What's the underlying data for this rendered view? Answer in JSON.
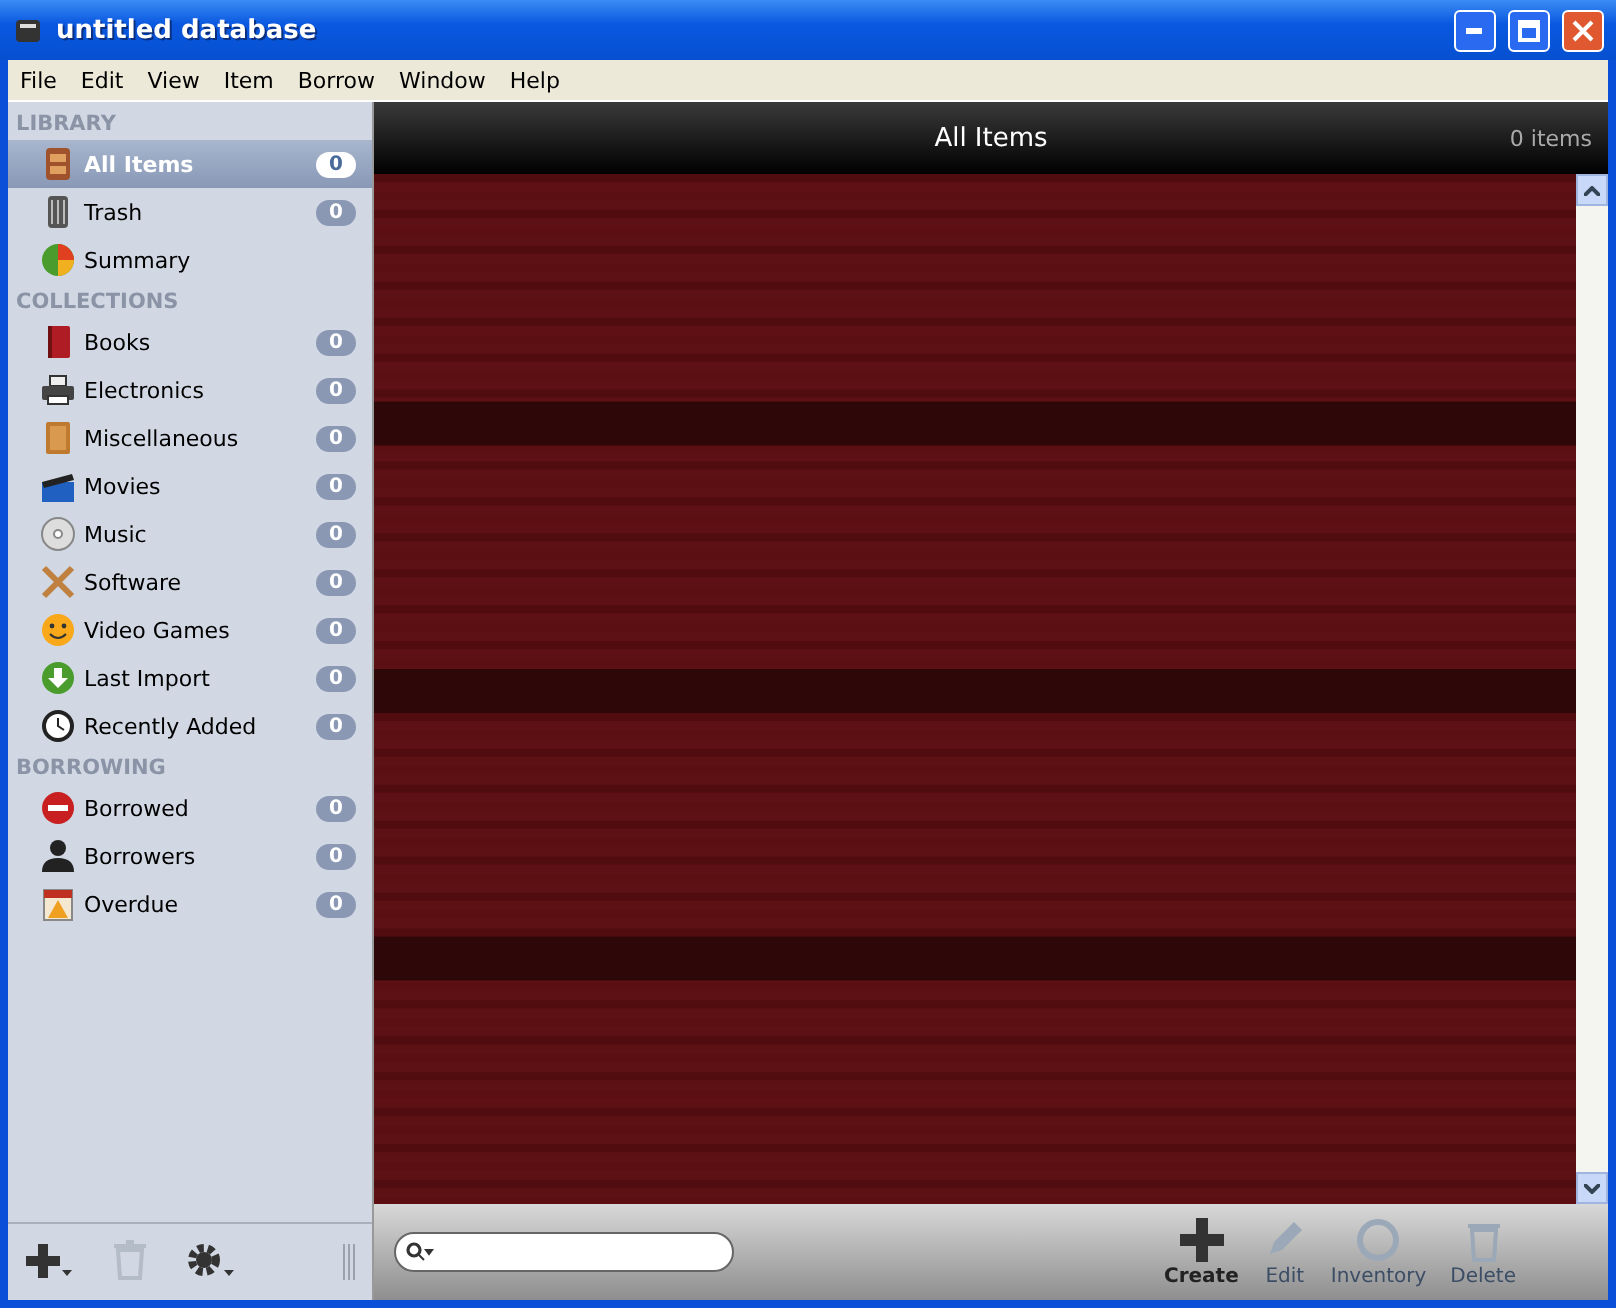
{
  "window": {
    "title": "untitled database"
  },
  "menu": [
    "File",
    "Edit",
    "View",
    "Item",
    "Borrow",
    "Window",
    "Help"
  ],
  "sidebar": {
    "sections": [
      {
        "title": "LIBRARY",
        "items": [
          {
            "label": "All Items",
            "count": "0",
            "selected": true
          },
          {
            "label": "Trash",
            "count": "0",
            "selected": false
          },
          {
            "label": "Summary",
            "selected": false
          }
        ]
      },
      {
        "title": "COLLECTIONS",
        "items": [
          {
            "label": "Books",
            "count": "0",
            "selected": false
          },
          {
            "label": "Electronics",
            "count": "0",
            "selected": false
          },
          {
            "label": "Miscellaneous",
            "count": "0",
            "selected": false
          },
          {
            "label": "Movies",
            "count": "0",
            "selected": false
          },
          {
            "label": "Music",
            "count": "0",
            "selected": false
          },
          {
            "label": "Software",
            "count": "0",
            "selected": false
          },
          {
            "label": "Video Games",
            "count": "0",
            "selected": false
          },
          {
            "label": "Last Import",
            "count": "0",
            "selected": false
          },
          {
            "label": "Recently Added",
            "count": "0",
            "selected": false
          }
        ]
      },
      {
        "title": "BORROWING",
        "items": [
          {
            "label": "Borrowed",
            "count": "0",
            "selected": false
          },
          {
            "label": "Borrowers",
            "count": "0",
            "selected": false
          },
          {
            "label": "Overdue",
            "count": "0",
            "selected": false
          }
        ]
      }
    ],
    "tools": [
      {
        "kind": "add",
        "disabled": false
      },
      {
        "kind": "trash",
        "disabled": true
      },
      {
        "kind": "gear",
        "disabled": false
      }
    ]
  },
  "main": {
    "title": "All Items",
    "count": "0 items"
  },
  "toolbar": [
    {
      "label": "Create",
      "disabled": false
    },
    {
      "label": "Edit",
      "disabled": true
    },
    {
      "label": "Inventory",
      "disabled": true
    },
    {
      "label": "Delete",
      "disabled": true
    }
  ]
}
